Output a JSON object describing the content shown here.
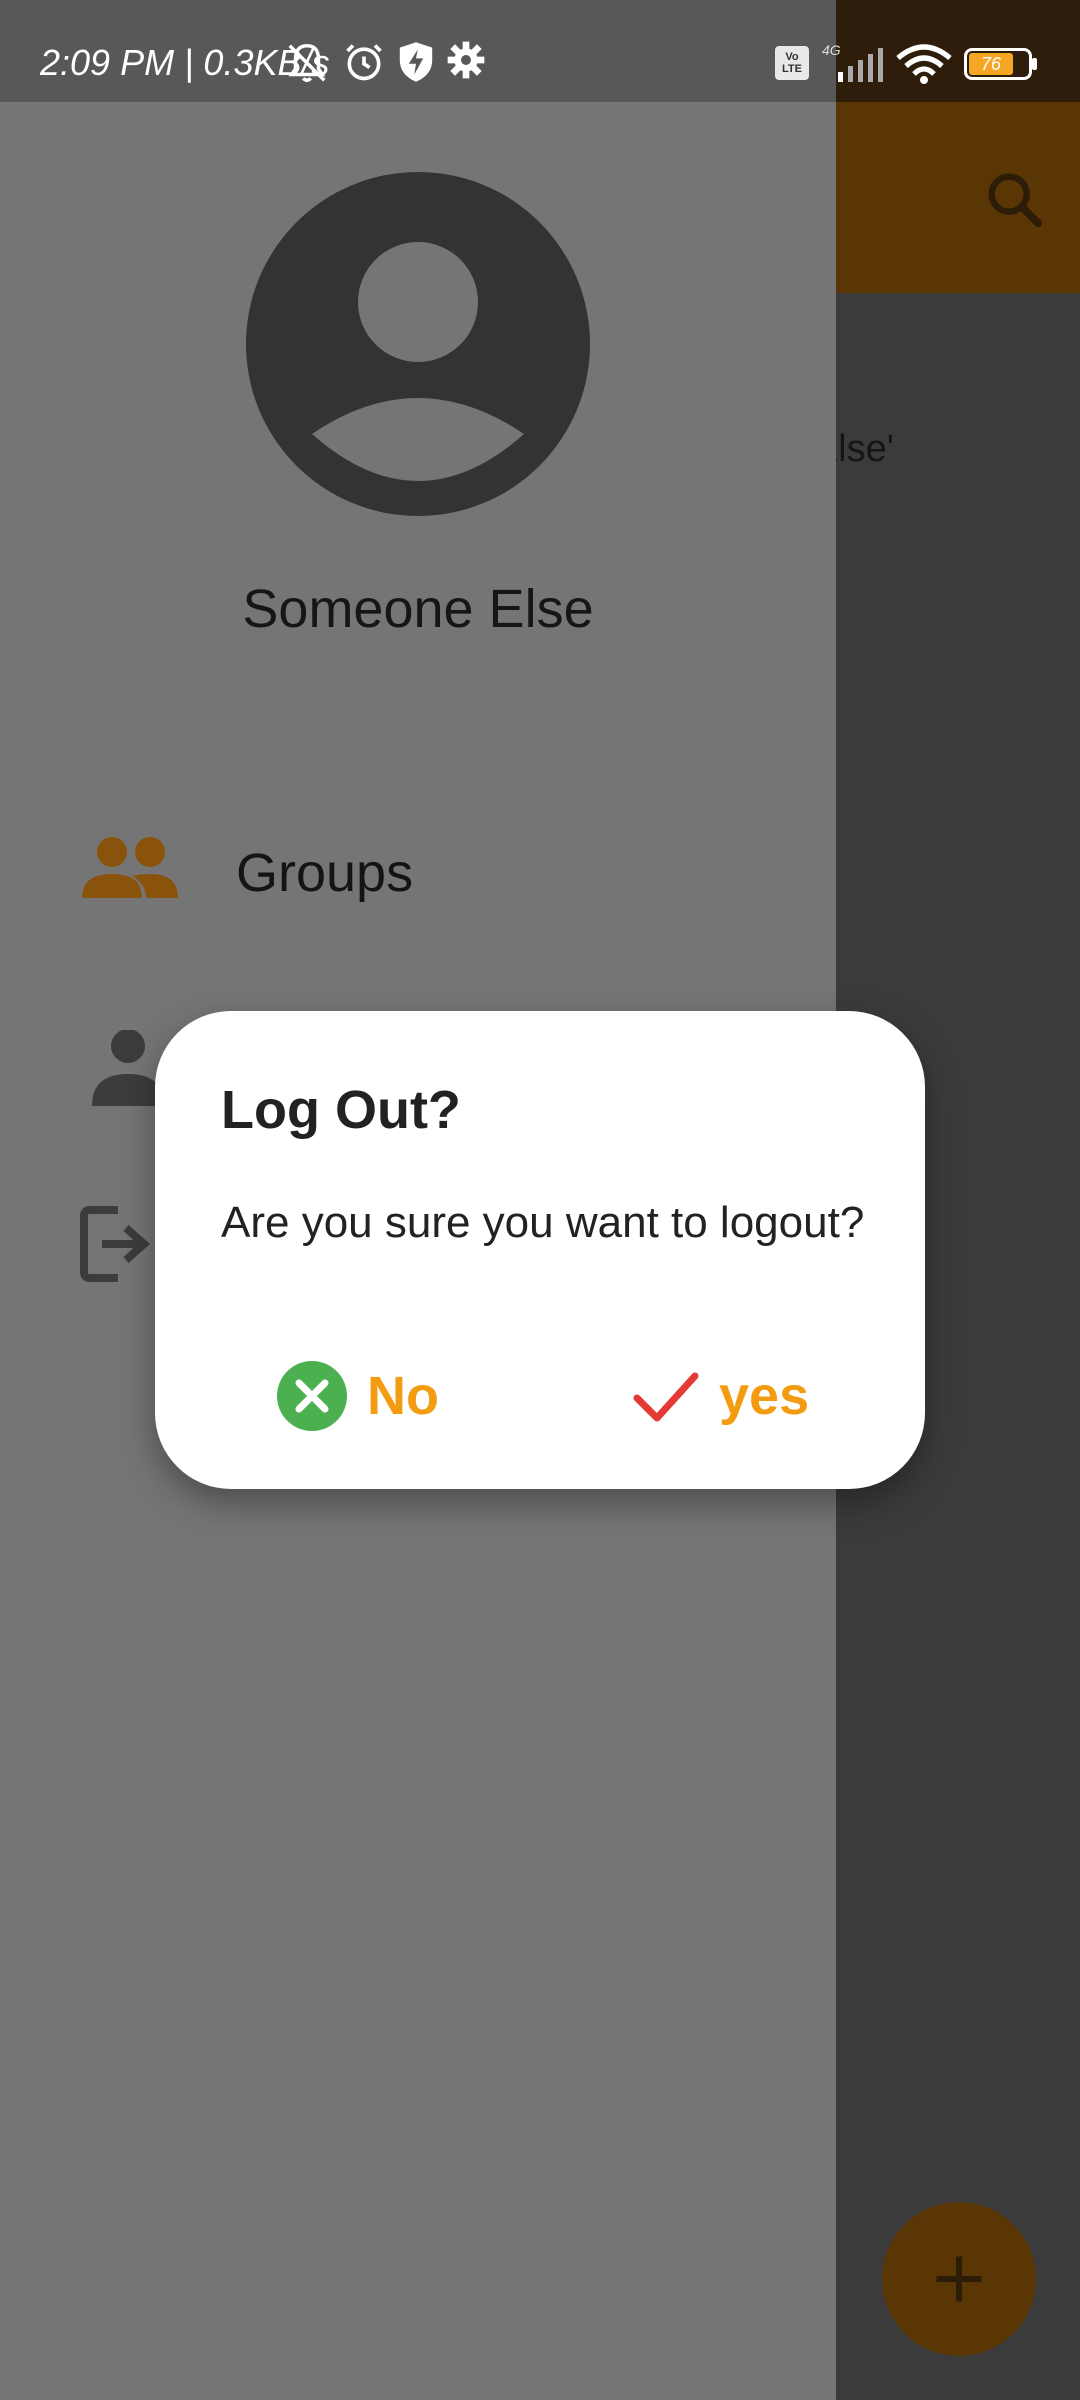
{
  "status_bar": {
    "time_speed": "2:09 PM | 0.3KB/s",
    "volte_label": "Vo\nLTE",
    "network_type": "4G",
    "battery_level": "76",
    "icons": [
      "mute-icon",
      "alarm-icon",
      "shield-icon",
      "settings-icon",
      "volte-icon",
      "signal-icon",
      "wifi-icon",
      "battery-icon"
    ]
  },
  "background_app": {
    "partial_text": "ne Else'",
    "search_icon": "search-icon",
    "fab_icon": "plus-icon"
  },
  "drawer": {
    "profile_name": "Someone Else",
    "avatar_icon": "account-circle-icon",
    "items": [
      {
        "label": "Groups",
        "icon": "groups-icon"
      },
      {
        "label": "",
        "icon": "person-icon"
      },
      {
        "label": "",
        "icon": "logout-icon"
      }
    ]
  },
  "dialog": {
    "title": "Log Out?",
    "message": "Are you sure you want to logout?",
    "no_label": "No",
    "yes_label": "yes"
  },
  "colors": {
    "accent": "#f39c12",
    "no_icon": "#4caf50",
    "yes_icon": "#e53935",
    "drawer_bg": "#757575",
    "dialog_bg": "#ffffff"
  }
}
